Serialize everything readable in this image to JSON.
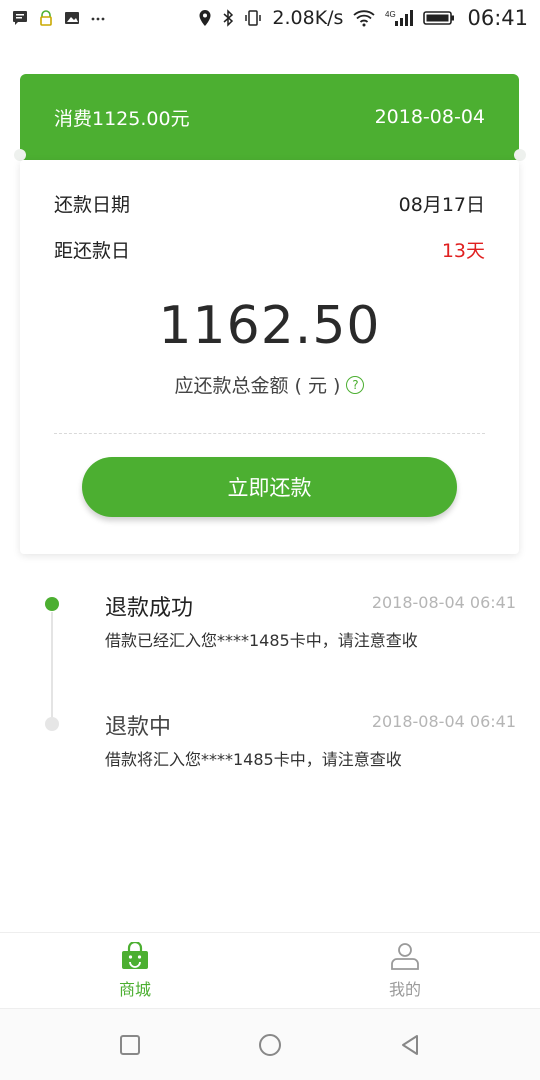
{
  "status_bar": {
    "speed": "2.08K/s",
    "network": "4G",
    "time": "06:41"
  },
  "card": {
    "header": {
      "spend": "消费1125.00元",
      "date": "2018-08-04"
    },
    "repay_date_label": "还款日期",
    "repay_date_value": "08月17日",
    "days_left_label": "距还款日",
    "days_left_value": "13天",
    "amount": "1162.50",
    "amount_label": "应还款总金额 ( 元 )",
    "repay_button": "立即还款"
  },
  "timeline": [
    {
      "title": "退款成功",
      "time": "2018-08-04 06:41",
      "desc": "借款已经汇入您****1485卡中，请注意查收",
      "status": "done"
    },
    {
      "title": "退款中",
      "time": "2018-08-04 06:41",
      "desc": "借款将汇入您****1485卡中，请注意查收",
      "status": "pending"
    }
  ],
  "bottom_nav": {
    "items": [
      {
        "label": "商城",
        "icon": "shopping-bag-icon",
        "active": true
      },
      {
        "label": "我的",
        "icon": "person-icon",
        "active": false
      }
    ]
  },
  "colors": {
    "accent": "#4caf31",
    "warning": "#e02020",
    "muted": "#b5b5b5"
  }
}
